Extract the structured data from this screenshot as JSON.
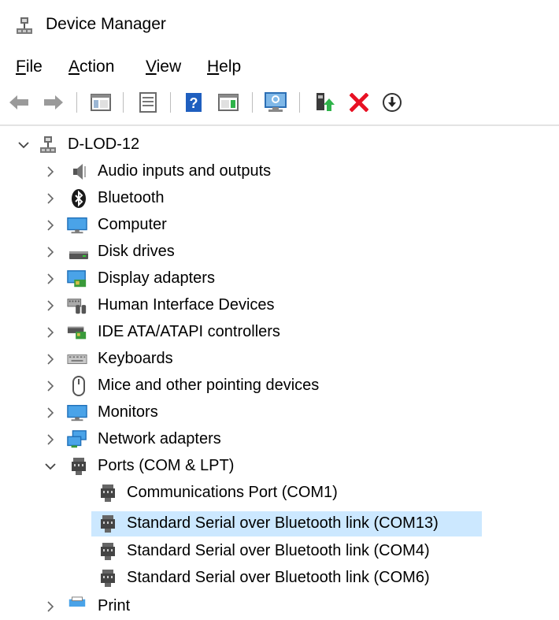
{
  "window": {
    "title": "Device Manager"
  },
  "menu": {
    "file": "File",
    "action": "Action",
    "view": "View",
    "help": "Help"
  },
  "toolbar": {
    "icons": [
      "back-arrow-icon",
      "forward-arrow-icon",
      "show-hide-console-tree-icon",
      "properties-icon",
      "help-icon",
      "action-pane-icon",
      "scan-hardware-icon",
      "update-driver-icon",
      "uninstall-device-icon",
      "disable-device-icon"
    ]
  },
  "tree": {
    "root": "D-LOD-12",
    "categories": [
      "Audio inputs and outputs",
      "Bluetooth",
      "Computer",
      "Disk drives",
      "Display adapters",
      "Human Interface Devices",
      "IDE ATA/ATAPI controllers",
      "Keyboards",
      "Mice and other pointing devices",
      "Monitors",
      "Network adapters",
      "Ports (COM & LPT)"
    ],
    "ports_children": [
      "Communications Port (COM1)",
      "Standard Serial over Bluetooth link (COM13)",
      "Standard Serial over Bluetooth link (COM4)",
      "Standard Serial over Bluetooth link (COM6)"
    ],
    "partial_next": "Print",
    "selected_child": "Standard Serial over Bluetooth link (COM13)"
  },
  "colors": {
    "selection": "#cce8ff",
    "accent": "#0078d7",
    "red_x": "#e81123",
    "green": "#2fb34a"
  }
}
